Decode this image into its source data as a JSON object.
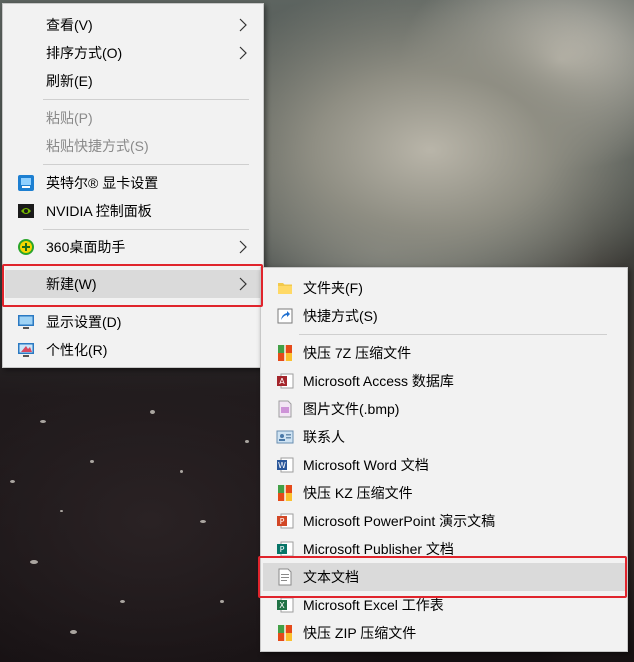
{
  "context_menu": {
    "view": "查看(V)",
    "sort_by": "排序方式(O)",
    "refresh": "刷新(E)",
    "paste": "粘贴(P)",
    "paste_shortcut": "粘贴快捷方式(S)",
    "intel_graphics": "英特尔® 显卡设置",
    "nvidia_panel": "NVIDIA 控制面板",
    "desktop_assistant_360": "360桌面助手",
    "new": "新建(W)",
    "display_settings": "显示设置(D)",
    "personalize": "个性化(R)"
  },
  "new_submenu": {
    "folder": "文件夹(F)",
    "shortcut": "快捷方式(S)",
    "kz_7z": "快压 7Z 压缩文件",
    "access_db": "Microsoft Access 数据库",
    "bmp_image": "图片文件(.bmp)",
    "contact": "联系人",
    "word_doc": "Microsoft Word 文档",
    "kz_kz": "快压 KZ 压缩文件",
    "powerpoint": "Microsoft PowerPoint 演示文稿",
    "publisher": "Microsoft Publisher 文档",
    "text_doc": "文本文档",
    "excel": "Microsoft Excel 工作表",
    "kz_zip": "快压 ZIP 压缩文件"
  },
  "colors": {
    "menu_bg": "#f2f2f2",
    "highlight_bg": "#dadada",
    "annotation_red": "#e0242c",
    "disabled_text": "#8a8a8a"
  },
  "state": {
    "hovered_menu_item": "new",
    "hovered_submenu_item": "text_doc",
    "annotated_items": [
      "new",
      "text_doc"
    ]
  }
}
